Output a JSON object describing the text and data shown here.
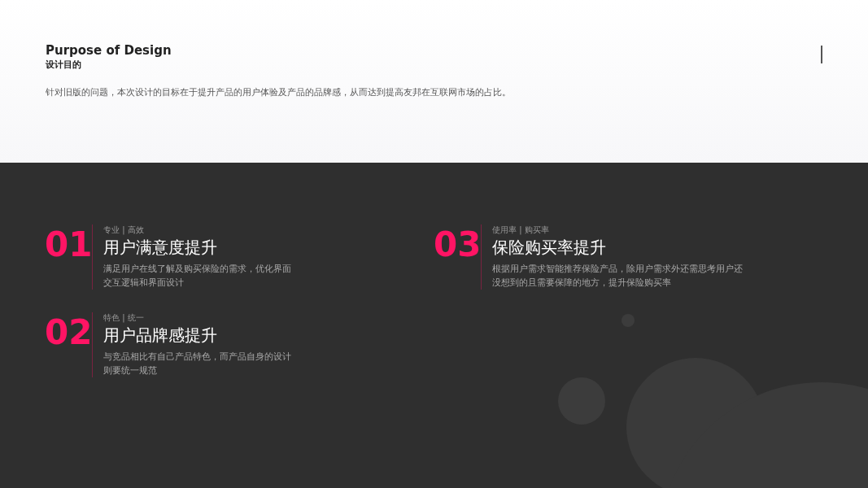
{
  "header": {
    "title": "Purpose of Design",
    "subtitle": "设计目的",
    "description": "针对旧版的问题，本次设计的目标在于提升产品的用户体验及产品的品牌感，从而达到提高友邦在互联网市场的占比。"
  },
  "goals": [
    {
      "number": "01",
      "tags": "专业 | 高效",
      "title": "用户满意度提升",
      "description": "满足用户在线了解及购买保险的需求，优化界面交互逻辑和界面设计"
    },
    {
      "number": "03",
      "tags": "使用率 | 购买率",
      "title": "保险购买率提升",
      "description": "根据用户需求智能推荐保险产品，除用户需求外还需思考用户还没想到的且需要保障的地方，提升保险购买率"
    },
    {
      "number": "02",
      "tags": "特色 | 统一",
      "title": "用户品牌感提升",
      "description": "与竞品相比有自己产品特色，而产品自身的设计则要统一规范"
    }
  ]
}
